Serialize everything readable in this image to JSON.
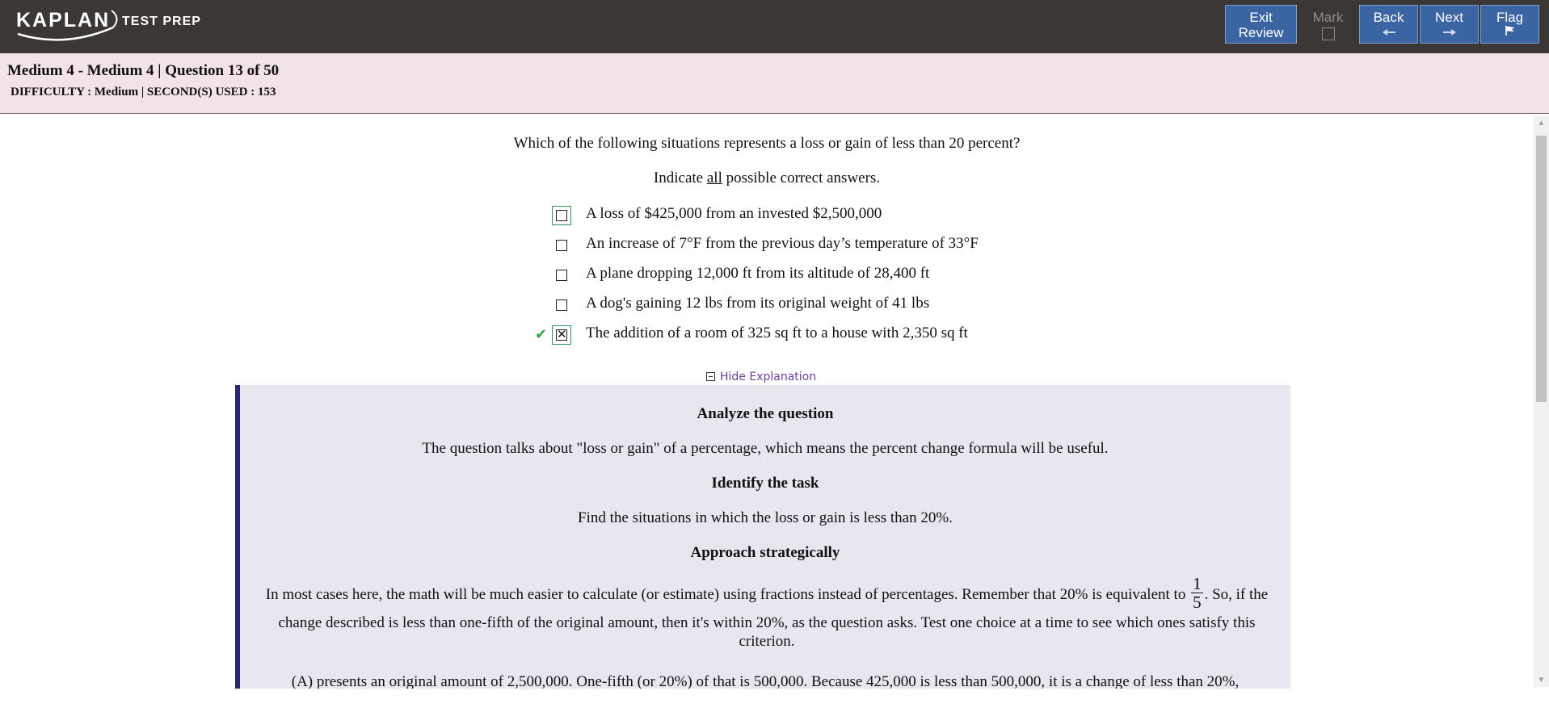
{
  "topbar": {
    "logo_brand": "KAPLAN",
    "logo_sub": "TEST PREP",
    "buttons": [
      {
        "label_line1": "Exit",
        "label_line2": "Review"
      },
      {
        "label_line1": "Mark"
      },
      {
        "label_line1": "Back",
        "icon": "arrow-left-icon"
      },
      {
        "label_line1": "Next",
        "icon": "arrow-right-icon"
      },
      {
        "label_line1": "Flag",
        "icon": "flag-icon"
      }
    ]
  },
  "info": {
    "title": "Medium 4 - Medium 4 | Question 13 of 50",
    "meta": "DIFFICULTY : Medium | SECOND(S) USED : 153"
  },
  "question": {
    "stem": "Which of the following situations represents a loss or gain of less than 20 percent?",
    "indicate_before": "Indicate ",
    "indicate_underlined": "all",
    "indicate_after": " possible correct answers.",
    "choices": [
      {
        "text": "A loss of $425,000 from an invested $2,500,000",
        "checked": false,
        "focused": true,
        "correct_mark": false
      },
      {
        "text": "An increase of 7°F from the previous day’s temperature of 33°F",
        "checked": false,
        "focused": false,
        "correct_mark": false
      },
      {
        "text": "A plane dropping 12,000 ft from its altitude of 28,400 ft",
        "checked": false,
        "focused": false,
        "correct_mark": false
      },
      {
        "text": "A dog's gaining 12 lbs from its original weight of 41 lbs",
        "checked": false,
        "focused": false,
        "correct_mark": false
      },
      {
        "text": "The addition of a room of 325 sq ft to a house with 2,350 sq ft",
        "checked": true,
        "focused": true,
        "correct_mark": true
      }
    ],
    "check_glyph": "✔",
    "x_glyph": "✕"
  },
  "explanation": {
    "toggle_label": "Hide Explanation",
    "h1": "Analyze the question",
    "p1": "The question talks about \"loss or gain\" of a percentage, which means the percent change formula will be useful.",
    "h2": "Identify the task",
    "p2": "Find the situations in which the loss or gain is less than 20%.",
    "h3": "Approach strategically",
    "p3_before": "In most cases here, the math will be much easier to calculate (or estimate) using fractions instead of percentages. Remember that 20% is equivalent to ",
    "frac_num": "1",
    "frac_den": "5",
    "p3_after": ". So, if the change described is less than one-fifth of the original amount, then it's within 20%, as the question asks. Test one choice at a time to see which ones satisfy this criterion.",
    "p4": "(A) presents an original amount of 2,500,000. One-fifth (or 20%) of that is 500,000. Because 425,000 is less than 500,000, it is a change of less than 20%,"
  },
  "colors": {
    "topbar": "#3a3735",
    "button_blue": "#3b64a3",
    "infobar": "#f2e3e6",
    "explain_bg": "#e8e6ee",
    "explain_border": "#2a2670",
    "link_purple": "#6d3e9c",
    "correct_green": "#2faa3b"
  }
}
